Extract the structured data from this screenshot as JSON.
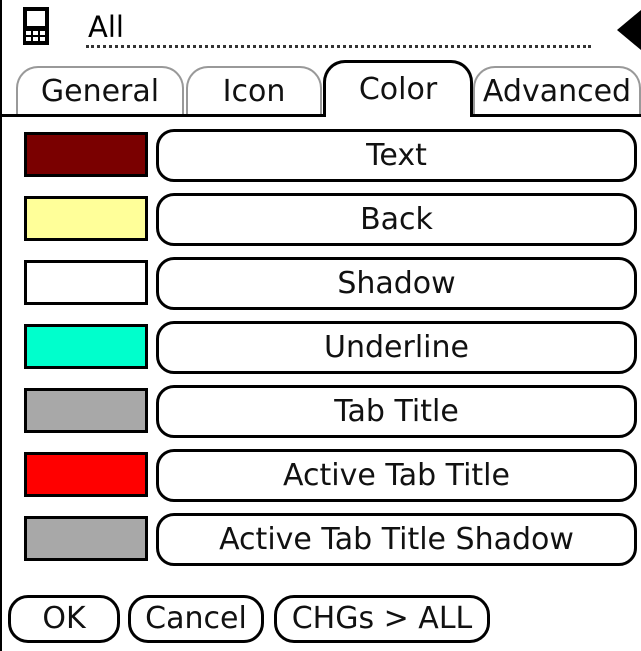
{
  "header": {
    "category_label": "All",
    "app_icon": "handheld-device-icon",
    "menu_arrow_icon": "left-triangle-icon"
  },
  "tabs": [
    {
      "label": "General"
    },
    {
      "label": "Icon"
    },
    {
      "label": "Color",
      "active": true
    },
    {
      "label": "Advanced"
    }
  ],
  "colors": [
    {
      "label": "Text",
      "swatch": "#7a0000"
    },
    {
      "label": "Back",
      "swatch": "#ffff99"
    },
    {
      "label": "Shadow",
      "swatch": "#ffffff"
    },
    {
      "label": "Underline",
      "swatch": "#00ffcc"
    },
    {
      "label": "Tab Title",
      "swatch": "#a8a8a8"
    },
    {
      "label": "Active Tab Title",
      "swatch": "#ff0000"
    },
    {
      "label": "Active Tab Title Shadow",
      "swatch": "#a8a8a8"
    }
  ],
  "buttons": {
    "ok": "OK",
    "cancel": "Cancel",
    "apply_all": "CHGs > ALL"
  }
}
